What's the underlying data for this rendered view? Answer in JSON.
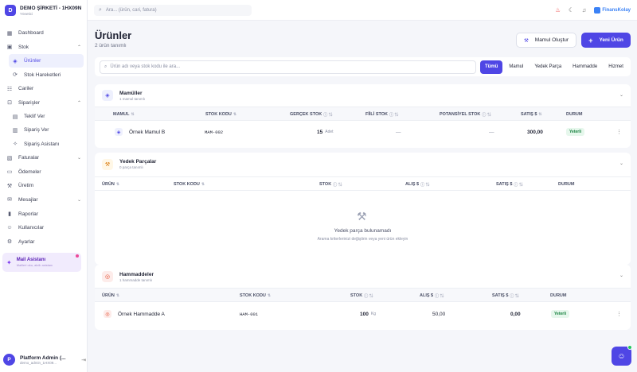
{
  "company": {
    "name": "DEMO ŞİRKETİ - 1HX09N",
    "subtitle": "Yönetici",
    "logo_letter": "D"
  },
  "sidebar": {
    "items": [
      {
        "label": "Dashboard",
        "icon": "grid-icon"
      },
      {
        "label": "Stok",
        "icon": "box-icon"
      },
      {
        "label": "Ürünler",
        "icon": "package-icon",
        "sub": true,
        "active": true
      },
      {
        "label": "Stok Hareketleri",
        "icon": "refresh-icon",
        "sub": true
      },
      {
        "label": "Cariler",
        "icon": "users-icon"
      },
      {
        "label": "Siparişler",
        "icon": "cart-icon"
      },
      {
        "label": "Teklif Ver",
        "icon": "document-icon",
        "sub": true
      },
      {
        "label": "Sipariş Ver",
        "icon": "clipboard-icon",
        "sub": true
      },
      {
        "label": "Sipariş Asistanı",
        "icon": "sparkle-icon",
        "sub": true
      },
      {
        "label": "Faturalar",
        "icon": "invoice-icon"
      },
      {
        "label": "Ödemeler",
        "icon": "card-icon"
      },
      {
        "label": "Üretim",
        "icon": "factory-icon"
      },
      {
        "label": "Mesajlar",
        "icon": "chat-icon"
      },
      {
        "label": "Raporlar",
        "icon": "chart-icon"
      },
      {
        "label": "Kullanıcılar",
        "icon": "user-icon"
      },
      {
        "label": "Ayarlar",
        "icon": "gear-icon"
      }
    ],
    "mail_assistant": {
      "title": "Mail Asistanı",
      "subtitle": "Mailleri oku, akıllı asistanı"
    }
  },
  "user": {
    "name": "Platform Admin (...",
    "email": "demo_admin_1HX09...",
    "initial": "P"
  },
  "topbar": {
    "search_placeholder": "Ara... (ürün, cari, fatura)",
    "brand": "FinansKolay"
  },
  "page": {
    "title": "Ürünler",
    "subtitle": "2 ürün tanımlı",
    "btn_mamul": "Mamul Oluştur",
    "btn_new": "Yeni Ürün",
    "filter_placeholder": "Ürün adı veya stok kodu ile ara...",
    "tabs": [
      "Tümü",
      "Mamul",
      "Yedek Parça",
      "Hammadde",
      "Hizmet"
    ]
  },
  "mamuller": {
    "title": "Mamüller",
    "count": "1 mamul tanımlı",
    "headers": [
      "MAMUL",
      "STOK KODU",
      "GERÇEK STOK",
      "FİİLİ STOK",
      "POTANSİYEL STOK",
      "SATIŞ $",
      "DURUM"
    ],
    "rows": [
      {
        "name": "Örnek Mamul B",
        "code": "MAM-002",
        "real": "15",
        "unit": "Adet",
        "fiili": "—",
        "pot": "—",
        "sale": "300,00",
        "status": "Yeterli"
      }
    ]
  },
  "yedek": {
    "title": "Yedek Parçalar",
    "count": "0 parça tanımlı",
    "headers": [
      "ÜRÜN",
      "STOK KODU",
      "STOK",
      "ALIŞ $",
      "SATIŞ $",
      "DURUM"
    ],
    "empty_title": "Yedek parça bulunamadı",
    "empty_sub": "Arama kriterlerinizi değiştirin veya yeni ürün ekleyin"
  },
  "hammaddeler": {
    "title": "Hammaddeler",
    "count": "1 hammadde tanımlı",
    "headers": [
      "ÜRÜN",
      "STOK KODU",
      "STOK",
      "ALIŞ $",
      "SATIŞ $",
      "DURUM"
    ],
    "rows": [
      {
        "name": "Örnek Hammadde A",
        "code": "HAM-001",
        "stock": "100",
        "unit": "Kg",
        "buy": "50,00",
        "sale": "0,00",
        "status": "Yeterli"
      }
    ]
  },
  "colors": {
    "accent": "#4f46e5",
    "success": "#15803d"
  }
}
